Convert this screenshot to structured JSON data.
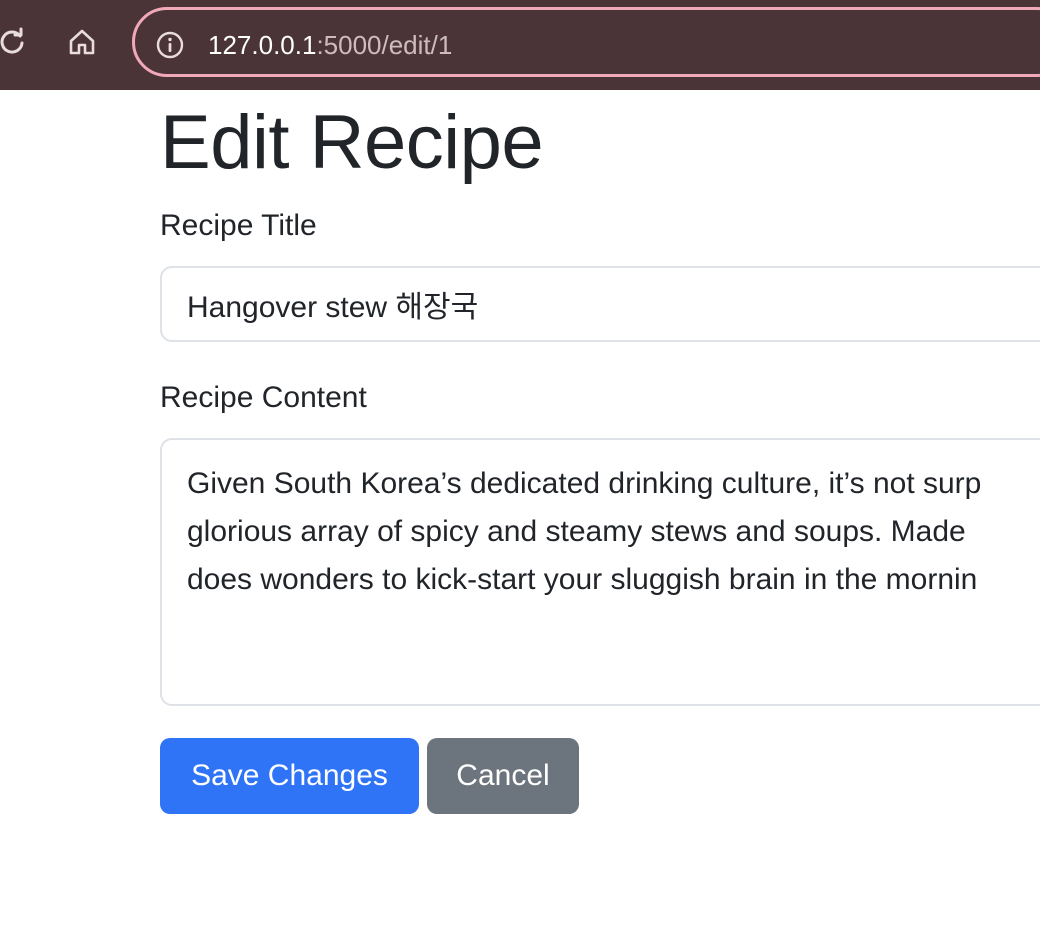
{
  "browser": {
    "url_host": "127.0.0.1",
    "url_rest": ":5000/edit/1",
    "icons": [
      "reload-icon",
      "home-icon",
      "info-icon"
    ]
  },
  "page": {
    "title": "Edit Recipe",
    "title_label": "Recipe Title",
    "title_value": "Hangover stew 해장국",
    "content_label": "Recipe Content",
    "content_lines": [
      "Given South Korea’s dedicated drinking culture, it’s not surp",
      "glorious array of spicy and steamy stews and soups. Made",
      "does wonders to kick-start your sluggish brain in the mornin"
    ],
    "save_label": "Save Changes",
    "cancel_label": "Cancel"
  },
  "colors": {
    "toolbar_bg": "#4b3438",
    "urlbar_border": "#f0a9b8",
    "primary": "#2f74f6",
    "secondary": "#6c757d"
  }
}
